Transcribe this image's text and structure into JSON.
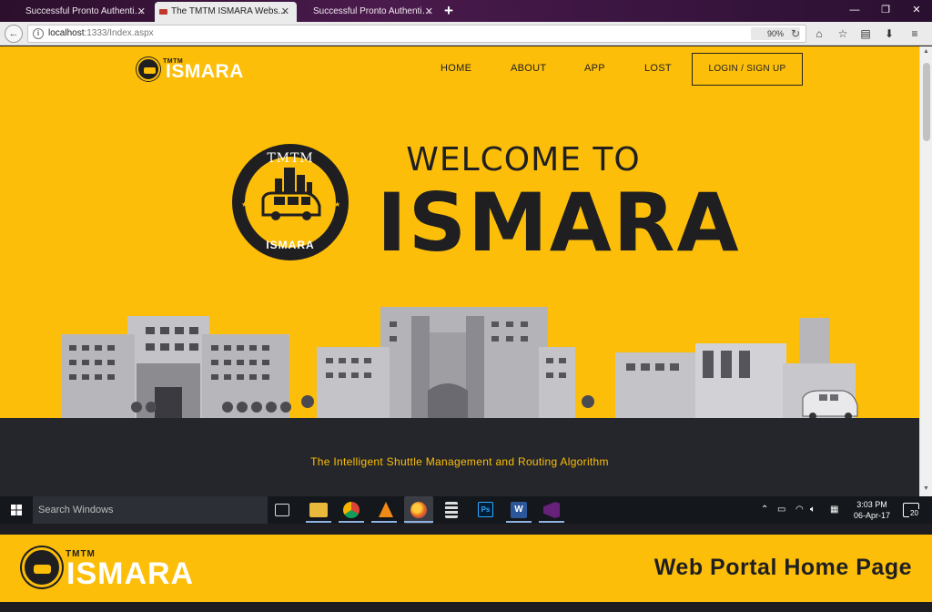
{
  "browser": {
    "tabs": [
      {
        "title": "Successful Pronto Authenticat...",
        "active": false
      },
      {
        "title": "The TMTM ISMARA Webs...",
        "active": true
      },
      {
        "title": "Successful Pronto Authenticat...",
        "active": false
      }
    ],
    "new_tab_symbol": "+",
    "url_host": "localhost",
    "url_path": ":1333/Index.aspx",
    "zoom": "90%",
    "icons": [
      "back-icon",
      "info-icon",
      "reload-icon",
      "home-icon",
      "bookmark-star-icon",
      "reader-icon",
      "download-icon",
      "menu-icon"
    ]
  },
  "site": {
    "logo_tag": "TMTM",
    "logo_word": "ISMARA",
    "nav": {
      "home": "HOME",
      "about": "ABOUT",
      "app": "APP",
      "lost": "LOST",
      "login": "LOGIN / SIGN UP"
    },
    "emblem_top": "TMTM",
    "emblem_bottom": "ISMARA",
    "hero_welcome": "WELCOME TO",
    "hero_title": "ISMARA",
    "tagline": "The Intelligent Shuttle Management and Routing Algorithm",
    "colors": {
      "brand_yellow": "#fcbe08",
      "dark": "#1f1f22",
      "ground": "#24262b"
    }
  },
  "taskbar": {
    "search_placeholder": "Search Windows",
    "apps": [
      "task-view-icon",
      "file-explorer-icon",
      "chrome-icon",
      "vlc-icon",
      "firefox-icon",
      "calculator-icon",
      "photoshop-icon",
      "word-icon",
      "visual-studio-icon"
    ],
    "photoshop_label": "Ps",
    "word_label": "W",
    "time": "3:03 PM",
    "date": "06-Apr-17",
    "notification_count": "20"
  },
  "banner": {
    "logo_tag": "TMTM",
    "logo_word": "ISMARA",
    "caption": "Web Portal Home Page"
  }
}
